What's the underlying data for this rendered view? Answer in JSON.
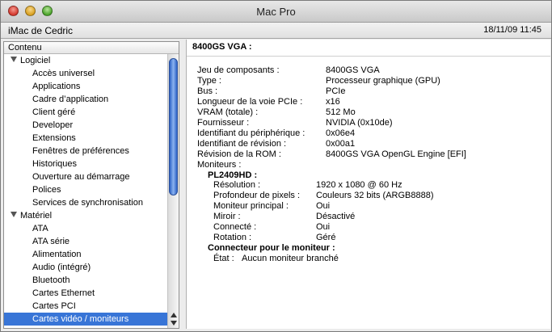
{
  "window": {
    "title": "Mac Pro"
  },
  "infobar": {
    "computer_name": "iMac de Cedric",
    "datetime": "18/11/09 11:45"
  },
  "sidebar": {
    "header": "Contenu",
    "rows": [
      {
        "kind": "cat",
        "label": "Logiciel"
      },
      {
        "kind": "item",
        "label": "Accès universel"
      },
      {
        "kind": "item",
        "label": "Applications"
      },
      {
        "kind": "item",
        "label": "Cadre d’application"
      },
      {
        "kind": "item",
        "label": "Client géré"
      },
      {
        "kind": "item",
        "label": "Developer"
      },
      {
        "kind": "item",
        "label": "Extensions"
      },
      {
        "kind": "item",
        "label": "Fenêtres de préférences"
      },
      {
        "kind": "item",
        "label": "Historiques"
      },
      {
        "kind": "item",
        "label": "Ouverture au démarrage"
      },
      {
        "kind": "item",
        "label": "Polices"
      },
      {
        "kind": "item",
        "label": "Services de synchronisation"
      },
      {
        "kind": "cat",
        "label": "Matériel"
      },
      {
        "kind": "item",
        "label": "ATA"
      },
      {
        "kind": "item",
        "label": "ATA série"
      },
      {
        "kind": "item",
        "label": "Alimentation"
      },
      {
        "kind": "item",
        "label": "Audio (intégré)"
      },
      {
        "kind": "item",
        "label": "Bluetooth"
      },
      {
        "kind": "item",
        "label": "Cartes Ethernet"
      },
      {
        "kind": "item",
        "label": "Cartes PCI"
      },
      {
        "kind": "item",
        "label": "Cartes vidéo / moniteurs",
        "selected": true
      }
    ]
  },
  "detail": {
    "title": "8400GS VGA :",
    "properties": [
      {
        "label": "Jeu de composants :",
        "value": "8400GS VGA",
        "level": 0
      },
      {
        "label": "Type :",
        "value": "Processeur graphique (GPU)",
        "level": 0
      },
      {
        "label": "Bus :",
        "value": "PCIe",
        "level": 0
      },
      {
        "label": "Longueur de la voie PCIe :",
        "value": "x16",
        "level": 0
      },
      {
        "label": "VRAM (totale) :",
        "value": "512 Mo",
        "level": 0
      },
      {
        "label": "Fournisseur :",
        "value": "NVIDIA (0x10de)",
        "level": 0
      },
      {
        "label": "Identifiant du périphérique :",
        "value": "0x06e4",
        "level": 0
      },
      {
        "label": "Identifiant de révision :",
        "value": "0x00a1",
        "level": 0
      },
      {
        "label": "Révision de la ROM :",
        "value": "8400GS VGA OpenGL Engine [EFI]",
        "level": 0
      },
      {
        "label": "Moniteurs :",
        "value": "",
        "level": 0
      },
      {
        "label": "PL2409HD :",
        "value": "",
        "level": 1,
        "bold": true
      },
      {
        "label": "Résolution :",
        "value": "1920 x 1080 @ 60 Hz",
        "level": 2
      },
      {
        "label": "Profondeur de pixels :",
        "value": "Couleurs 32 bits (ARGB8888)",
        "level": 2
      },
      {
        "label": "Moniteur principal :",
        "value": "Oui",
        "level": 2
      },
      {
        "label": "Miroir :",
        "value": "Désactivé",
        "level": 2
      },
      {
        "label": "Connecté :",
        "value": "Oui",
        "level": 2
      },
      {
        "label": "Rotation :",
        "value": "Géré",
        "level": 2
      },
      {
        "label": "Connecteur pour le moniteur :",
        "value": "",
        "level": 1,
        "bold": true
      },
      {
        "label": "État :",
        "value": "Aucun moniteur branché",
        "level": 3
      }
    ]
  }
}
